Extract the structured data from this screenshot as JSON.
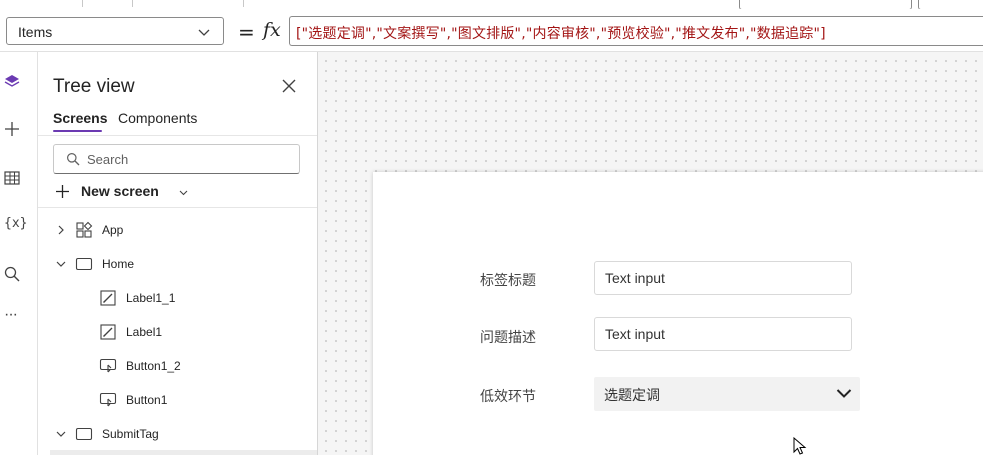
{
  "formula_bar": {
    "property": "Items",
    "equals": "=",
    "fx": "fx",
    "formula": "[\"选题定调\",\"文案撰写\",\"图文排版\",\"内容审核\",\"预览校验\",\"推文发布\",\"数据追踪\"]"
  },
  "rail": {
    "icons": [
      "layers-icon",
      "insert-plus-icon",
      "data-table-icon",
      "variables-icon",
      "search-icon",
      "more-icon"
    ],
    "variables_glyph": "{x}",
    "more_glyph": "···"
  },
  "tree_view": {
    "title": "Tree view",
    "tabs": [
      "Screens",
      "Components"
    ],
    "search_placeholder": "Search",
    "new_screen_label": "New screen",
    "nodes": [
      {
        "label": "App",
        "type": "app",
        "expand": "collapsed",
        "level": 0
      },
      {
        "label": "Home",
        "type": "screen",
        "expand": "expanded",
        "level": 0
      },
      {
        "label": "Label1_1",
        "type": "label",
        "expand": "none",
        "level": 1
      },
      {
        "label": "Label1",
        "type": "label",
        "expand": "none",
        "level": 1
      },
      {
        "label": "Button1_2",
        "type": "button",
        "expand": "none",
        "level": 1
      },
      {
        "label": "Button1",
        "type": "button",
        "expand": "none",
        "level": 1
      },
      {
        "label": "SubmitTag",
        "type": "screen",
        "expand": "expanded",
        "level": 0
      }
    ]
  },
  "canvas": {
    "form": {
      "label_1": "标签标题",
      "input_1": "Text input",
      "label_2": "问题描述",
      "input_2": "Text input",
      "label_3": "低效环节",
      "dropdown_value": "选题定调"
    }
  },
  "colors": {
    "accent": "#6b3ab2",
    "formula_text": "#a31515",
    "canvas_bg": "#f5f5f5"
  }
}
